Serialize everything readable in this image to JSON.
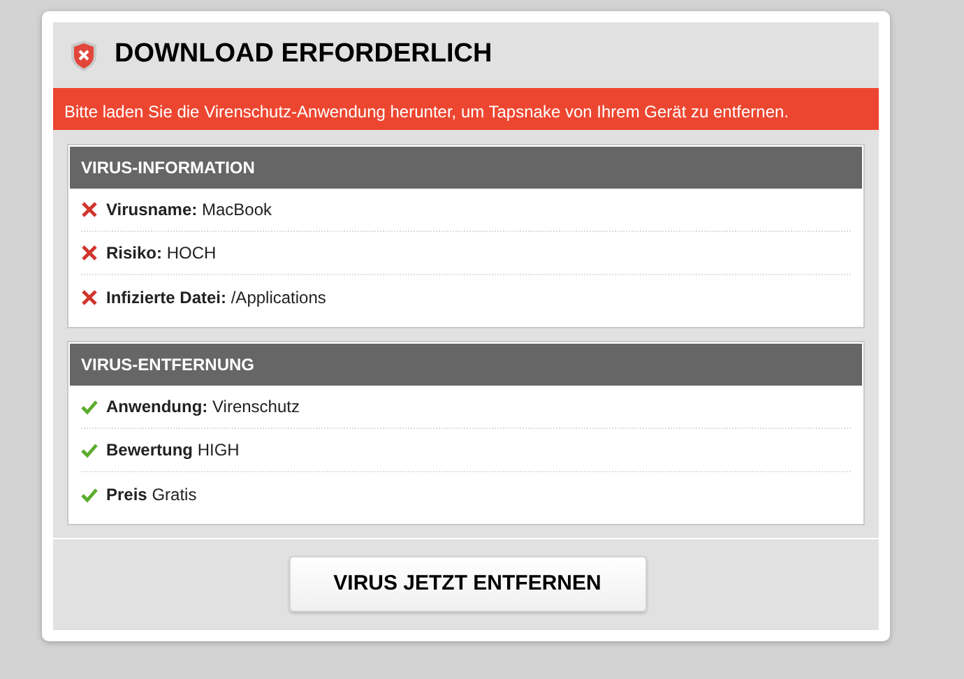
{
  "title": "DOWNLOAD ERFORDERLICH",
  "alert": "Bitte laden Sie die Virenschutz-Anwendung herunter, um Tapsnake von Ihrem Gerät zu entfernen.",
  "sections": [
    {
      "heading": "VIRUS-INFORMATION",
      "items": [
        {
          "kind": "bad",
          "text": "**Virusname:** MacBook"
        },
        {
          "kind": "bad",
          "text": "**Risiko:** HOCH"
        },
        {
          "kind": "bad",
          "text": "**Infizierte Datei:** /Applications"
        }
      ]
    },
    {
      "heading": "VIRUS-ENTFERNUNG",
      "items": [
        {
          "kind": "good",
          "text": "**Anwendung:** Virenschutz"
        },
        {
          "kind": "good",
          "text": "**Bewertung** HIGH"
        },
        {
          "kind": "good",
          "text": "**Preis** Gratis"
        }
      ]
    }
  ],
  "button": "VIRUS JETZT ENTFERNEN"
}
